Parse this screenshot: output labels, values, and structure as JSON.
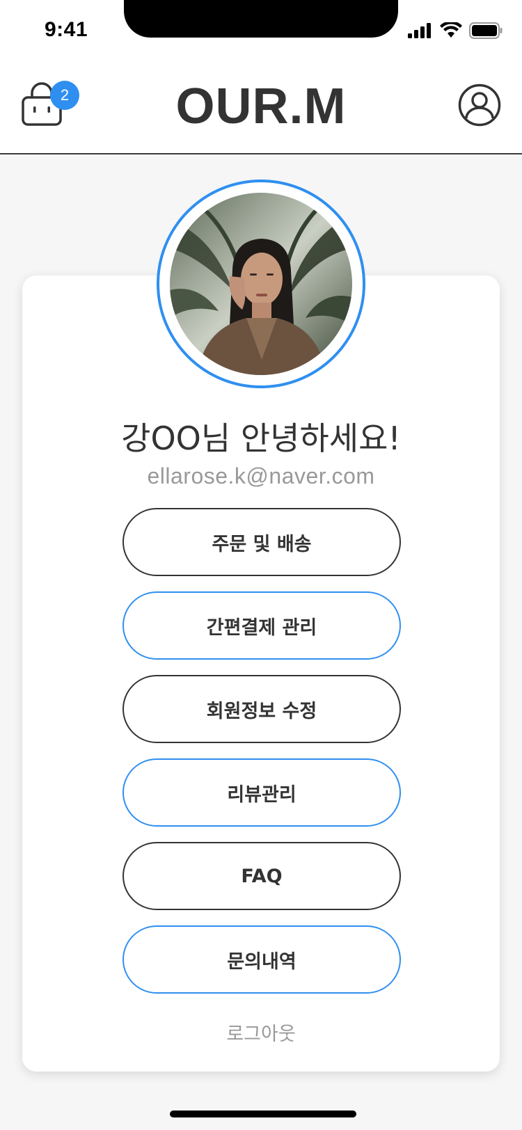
{
  "status_bar": {
    "time": "9:41"
  },
  "header": {
    "logo": "OUR.M",
    "cart_count": "2"
  },
  "profile": {
    "greeting": "강OO님 안녕하세요!",
    "email": "ellarose.k@naver.com"
  },
  "menu": [
    {
      "label": "주문 및 배송",
      "accent": "dark"
    },
    {
      "label": "간편결제 관리",
      "accent": "blue"
    },
    {
      "label": "회원정보 수정",
      "accent": "dark"
    },
    {
      "label": "리뷰관리",
      "accent": "blue"
    },
    {
      "label": "FAQ",
      "accent": "dark"
    },
    {
      "label": "문의내역",
      "accent": "blue"
    }
  ],
  "logout_label": "로그아웃",
  "colors": {
    "accent": "#2f8ff0",
    "dark": "#333333",
    "muted": "#999999"
  },
  "icons": [
    "signal-icon",
    "wifi-icon",
    "battery-icon",
    "shopping-bag-icon",
    "user-icon"
  ]
}
